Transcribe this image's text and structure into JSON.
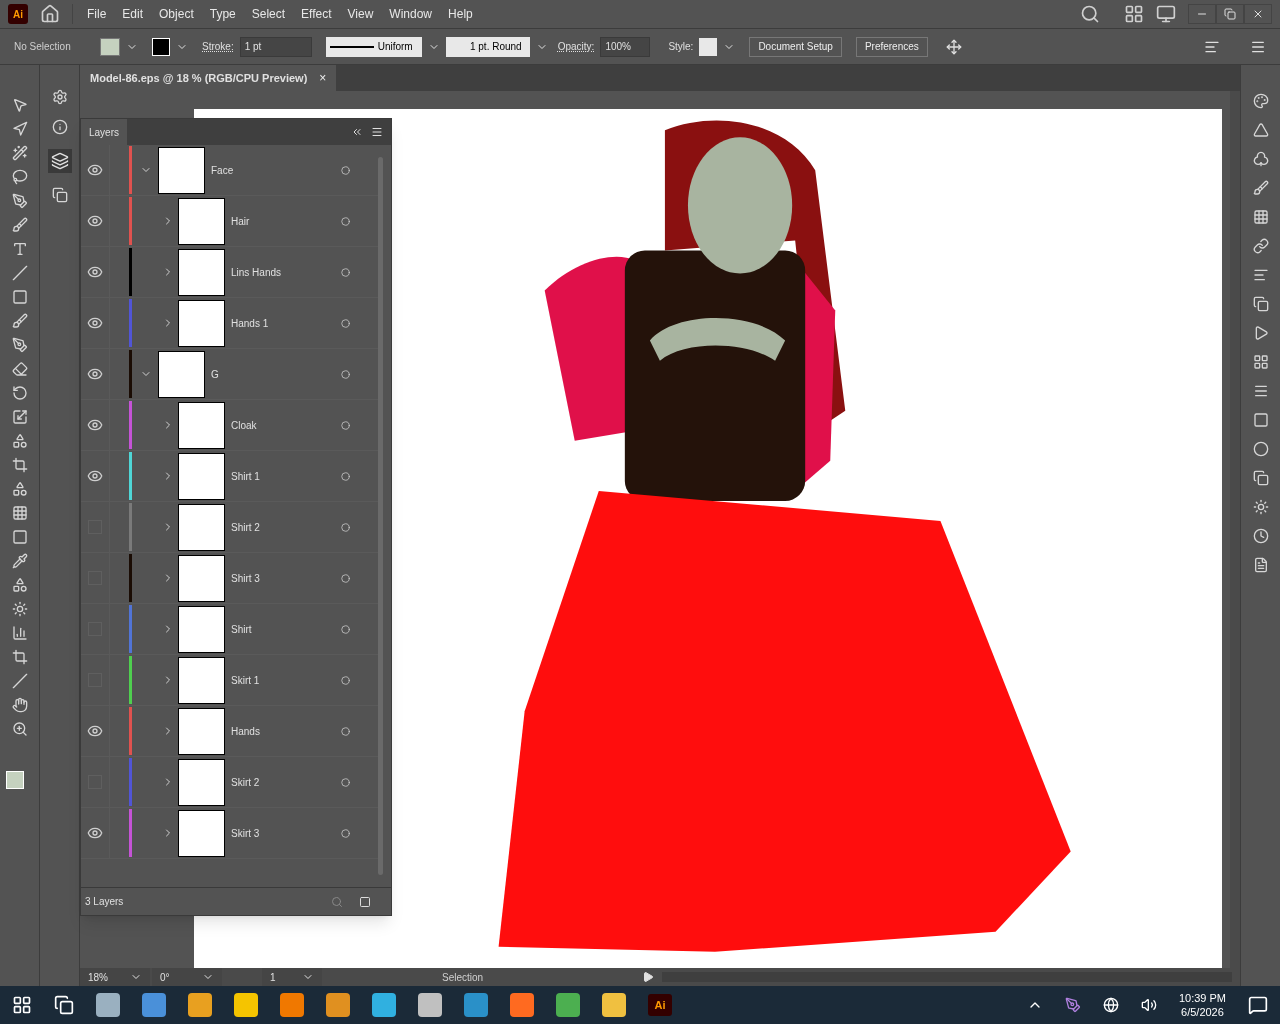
{
  "app_logo": "Ai",
  "menu": [
    "File",
    "Edit",
    "Object",
    "Type",
    "Select",
    "Effect",
    "View",
    "Window",
    "Help"
  ],
  "control_bar": {
    "selection": "No Selection",
    "fill_swatch": {
      "color": "#c5d1bf"
    },
    "stroke_label": "Stroke:",
    "stroke_weight": "1 pt",
    "profile": "Uniform",
    "brush": "1 pt. Round",
    "opacity_label": "Opacity:",
    "opacity": "100%",
    "style_label": "Style:",
    "buttons": [
      "Document Setup",
      "Preferences"
    ]
  },
  "document_tab": {
    "title": "Model-86.eps @ 18 % (RGB/CPU Preview)",
    "close": "×"
  },
  "layers_panel": {
    "title": "Layers",
    "footer": "3 Layers",
    "layers": [
      {
        "name": "Face",
        "color": "#e0524f",
        "visible": true,
        "expanded": true,
        "children": [
          {
            "name": "Hair",
            "color": "#e0524f",
            "visible": true,
            "expanded": false
          },
          {
            "name": "Lins Hands",
            "color": "#000000",
            "visible": true,
            "expanded": false
          },
          {
            "name": "Hands 1",
            "color": "#5155d6",
            "visible": true,
            "expanded": false
          }
        ]
      },
      {
        "name": "G",
        "color": "#1a0c04",
        "visible": true,
        "expanded": true,
        "children": [
          {
            "name": "Cloak",
            "color": "#c553d6",
            "visible": true,
            "expanded": false
          },
          {
            "name": "Shirt 1",
            "color": "#4fd6d6",
            "visible": true,
            "expanded": false
          },
          {
            "name": "Shirt 2",
            "color": "#7a7a7a",
            "visible": false,
            "expanded": false
          },
          {
            "name": "Shirt 3",
            "color": "#1a0c04",
            "visible": false,
            "expanded": false
          },
          {
            "name": "Shirt",
            "color": "#5174d6",
            "visible": false,
            "expanded": false
          },
          {
            "name": "Skirt 1",
            "color": "#4fcf4f",
            "visible": false,
            "expanded": false
          },
          {
            "name": "Hands",
            "color": "#e0524f",
            "visible": true,
            "expanded": false
          },
          {
            "name": "Skirt 2",
            "color": "#5155d6",
            "visible": false,
            "expanded": false
          },
          {
            "name": "Skirt 3",
            "color": "#c553d6",
            "visible": true,
            "expanded": false
          }
        ]
      }
    ]
  },
  "status_bar": {
    "zoom": "18%",
    "rotation": "0°",
    "artboard": "1",
    "tool": "Selection"
  },
  "taskbar": {
    "pinned_app": "Ai",
    "time": "10:39 PM",
    "date": "6/5/2026"
  }
}
